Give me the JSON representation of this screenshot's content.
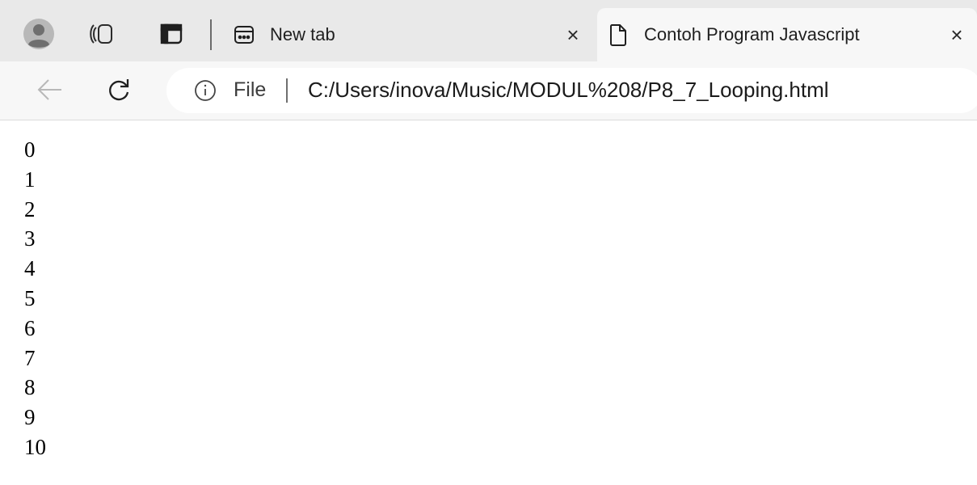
{
  "tabs": [
    {
      "title": "New tab",
      "close": "×",
      "icon": "new-tab-page-icon",
      "active": false
    },
    {
      "title": "Contoh Program Javascript",
      "close": "×",
      "icon": "document-icon",
      "active": true
    }
  ],
  "toolbar": {
    "site_chip": "File",
    "url": "C:/Users/inova/Music/MODUL%208/P8_7_Looping.html"
  },
  "page": {
    "lines": [
      "0",
      "1",
      "2",
      "3",
      "4",
      "5",
      "6",
      "7",
      "8",
      "9",
      "10"
    ]
  },
  "colors": {
    "tabstrip": "#e9e9e9",
    "toolbar": "#f7f7f7",
    "addressbar": "#ffffff",
    "text": "#1f1f1f"
  }
}
